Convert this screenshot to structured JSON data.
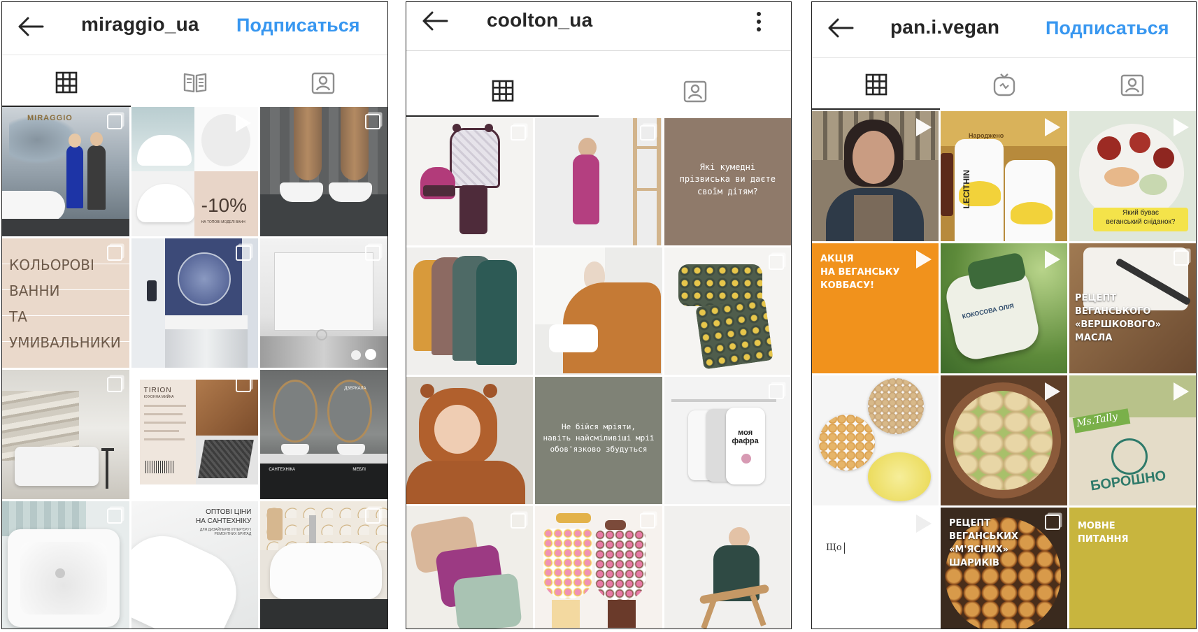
{
  "panels": [
    {
      "username": "miraggio_ua",
      "follow_label": "Подписаться",
      "tabs": [
        "grid-icon",
        "guide-icon",
        "tagged-icon"
      ],
      "posts": {
        "p1_logo": "MIRAGGIO",
        "p2_discount": "-10%",
        "p2_sub": "НА ТОПОВІ МОДЕЛІ ВАНН",
        "p4_lines": [
          "КОЛЬОРОВІ",
          "ВАННИ",
          "ТА",
          "УМИВАЛЬНИКИ"
        ],
        "p8_title": "TIRION",
        "p8_sub": "КУХОННА МИЙКА",
        "p9_label_a": "ДЗЕРКАЛА",
        "p9_label_b": "САНТЕХНІКА",
        "p9_label_c": "МЕБЛІ",
        "p11_lines": [
          "ОПТОВІ ЦІНИ",
          "НА САНТЕХНІКУ"
        ],
        "p11_sub": "ДЛЯ ДИЗАЙНЕРІВ ІНТЕР'ЄРУ І РЕМОНТНИХ БРИГАД"
      }
    },
    {
      "username": "coolton_ua",
      "tabs": [
        "grid-icon",
        "tagged-icon"
      ],
      "posts": {
        "p3_lines": [
          "Які кумедні",
          "прізвиська ви даєте",
          "своїм дітям?"
        ],
        "p8_lines": [
          "Не бійся мріяти,",
          "навіть найсміливіші мрії",
          "обов'язково збудуться"
        ],
        "p9_print": "моя фафра"
      }
    },
    {
      "username": "pan.i.vegan",
      "follow_label": "Подписаться",
      "tabs": [
        "grid-icon",
        "igtv-icon",
        "tagged-icon"
      ],
      "posts": {
        "p2_label": "LECITHIN",
        "p2_sign": "Народжено",
        "p3_lines": [
          "Який буває",
          "веганський сніданок?"
        ],
        "p4_lines": [
          "АКЦІЯ",
          "НА ВЕГАНСЬКУ",
          "КОВБАСУ!"
        ],
        "p5_label": "КОКОСОВА ОЛІЯ",
        "p6_lines": [
          "РЕЦЕПТ",
          "ВЕГАНСЬКОГО",
          "«ВЕРШКОВОГО»",
          "МАСЛА"
        ],
        "p9_brand": "Ms.Tally",
        "p9_label": "БОРОШНО",
        "p10_text": "Що",
        "p11_lines": [
          "РЕЦЕПТ",
          "ВЕГАНСЬКИХ",
          "«М'ЯСНИХ»",
          "ШАРИКІВ"
        ],
        "p12_lines": [
          "МОВНЕ",
          "ПИТАННЯ"
        ]
      }
    }
  ]
}
